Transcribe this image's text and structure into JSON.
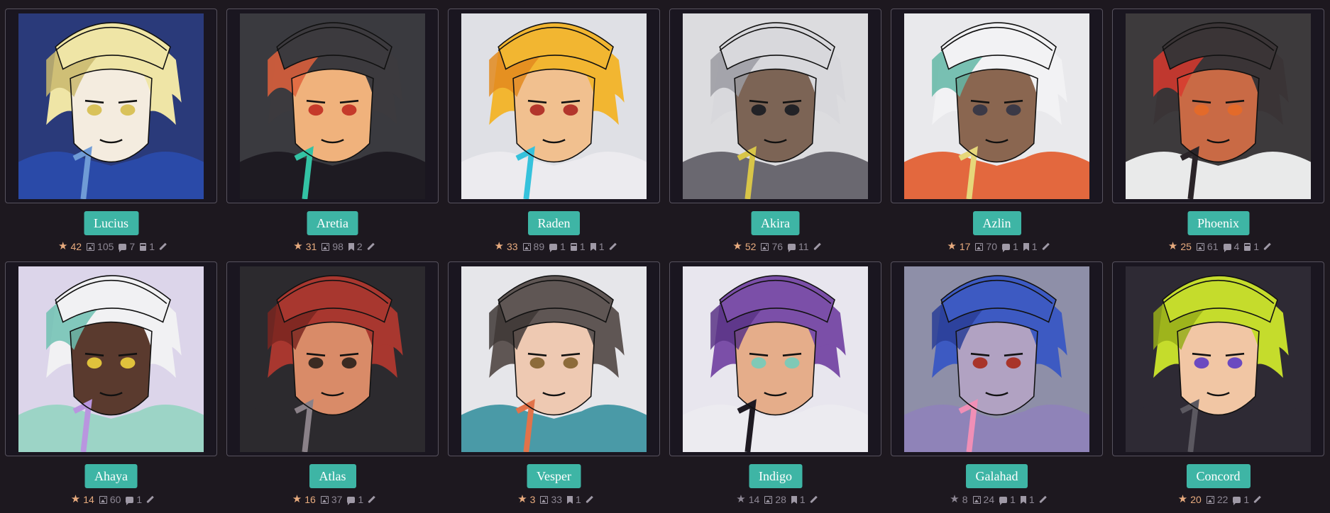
{
  "characters": [
    {
      "name": "Lucius",
      "favorites": "42",
      "favorites_active": true,
      "images": "105",
      "comments": "7",
      "folders": "1",
      "bookmarks": null,
      "colors": {
        "bg": "#2a3a7a",
        "hair": "#efe5a6",
        "hair_shade": "#c9b86d",
        "skin": "#f4ecdf",
        "eye": "#d9c25a",
        "outfit": "#2a4aa8",
        "accent": "#6f9bd6"
      }
    },
    {
      "name": "Aretia",
      "favorites": "31",
      "favorites_active": true,
      "images": "98",
      "comments": null,
      "folders": null,
      "bookmarks": "2",
      "colors": {
        "bg": "#3a3a3f",
        "hair": "#3c3a3e",
        "hair_shade": "#e0613c",
        "skin": "#f0b27c",
        "eye": "#c53a2a",
        "outfit": "#1e1b22",
        "accent": "#33c3a4"
      }
    },
    {
      "name": "Raden",
      "favorites": "33",
      "favorites_active": true,
      "images": "89",
      "comments": "1",
      "folders": "1",
      "bookmarks": "1",
      "colors": {
        "bg": "#dfe0e5",
        "hair": "#f2b631",
        "hair_shade": "#e38a1f",
        "skin": "#f1c08f",
        "eye": "#b3362c",
        "outfit": "#ecebef",
        "accent": "#35c2dc"
      }
    },
    {
      "name": "Akira",
      "favorites": "52",
      "favorites_active": true,
      "images": "76",
      "comments": "11",
      "folders": null,
      "bookmarks": null,
      "colors": {
        "bg": "#dcdcdf",
        "hair": "#d8d8dc",
        "hair_shade": "#9b9ba2",
        "skin": "#7c6455",
        "eye": "#222226",
        "outfit": "#6a6870",
        "accent": "#d8c548"
      }
    },
    {
      "name": "Azlin",
      "favorites": "17",
      "favorites_active": true,
      "images": "70",
      "comments": "1",
      "folders": null,
      "bookmarks": "1",
      "colors": {
        "bg": "#e9e9ec",
        "hair": "#f2f2f4",
        "hair_shade": "#63b7a6",
        "skin": "#8a6650",
        "eye": "#3b3946",
        "outfit": "#e3683e",
        "accent": "#e6d77a"
      }
    },
    {
      "name": "Phoenix",
      "favorites": "25",
      "favorites_active": true,
      "images": "61",
      "comments": "4",
      "folders": "1",
      "bookmarks": null,
      "colors": {
        "bg": "#3d3a3c",
        "hair": "#3a3436",
        "hair_shade": "#d83a2e",
        "skin": "#c96a45",
        "eye": "#e36a2a",
        "outfit": "#e9eaea",
        "accent": "#2a2428"
      }
    },
    {
      "name": "Ahaya",
      "favorites": "14",
      "favorites_active": true,
      "images": "60",
      "comments": "1",
      "folders": null,
      "bookmarks": null,
      "colors": {
        "bg": "#dcd5ea",
        "hair": "#f1f1f3",
        "hair_shade": "#6fc1b1",
        "skin": "#5a3a2e",
        "eye": "#e0c23c",
        "outfit": "#9cd4c6",
        "accent": "#b995df"
      }
    },
    {
      "name": "Atlas",
      "favorites": "16",
      "favorites_active": true,
      "images": "37",
      "comments": "1",
      "folders": null,
      "bookmarks": null,
      "colors": {
        "bg": "#2c2a2e",
        "hair": "#a8372f",
        "hair_shade": "#7a2620",
        "skin": "#d98b68",
        "eye": "#3a2a22",
        "outfit": "#2c2a2e",
        "accent": "#8a8188"
      }
    },
    {
      "name": "Vesper",
      "favorites": "3",
      "favorites_active": true,
      "images": "33",
      "comments": null,
      "folders": null,
      "bookmarks": "1",
      "colors": {
        "bg": "#e6e6ea",
        "hair": "#5f5654",
        "hair_shade": "#3e3736",
        "skin": "#eec9b2",
        "eye": "#8d6b3a",
        "outfit": "#4a9aa7",
        "accent": "#e2734a"
      }
    },
    {
      "name": "Indigo",
      "favorites": "14",
      "favorites_active": false,
      "images": "28",
      "comments": null,
      "folders": null,
      "bookmarks": "1",
      "colors": {
        "bg": "#e8e6ee",
        "hair": "#7b4fa8",
        "hair_shade": "#5a3486",
        "skin": "#e5ad8a",
        "eye": "#7fc9b6",
        "outfit": "#ecebf0",
        "accent": "#1e1a22"
      }
    },
    {
      "name": "Galahad",
      "favorites": "8",
      "favorites_active": false,
      "images": "24",
      "comments": "1",
      "folders": null,
      "bookmarks": "1",
      "colors": {
        "bg": "#8e8fa8",
        "hair": "#3d5ac2",
        "hair_shade": "#2a3e96",
        "skin": "#b1a2c2",
        "eye": "#a8342a",
        "outfit": "#8f83b8",
        "accent": "#f08fb6"
      }
    },
    {
      "name": "Concord",
      "favorites": "20",
      "favorites_active": true,
      "images": "22",
      "comments": "1",
      "folders": null,
      "bookmarks": null,
      "colors": {
        "bg": "#2e2a34",
        "hair": "#c5dc2c",
        "hair_shade": "#97ad1a",
        "skin": "#f1c6a4",
        "eye": "#6b4ac0",
        "outfit": "#2e2a34",
        "accent": "#5b5860"
      }
    }
  ]
}
